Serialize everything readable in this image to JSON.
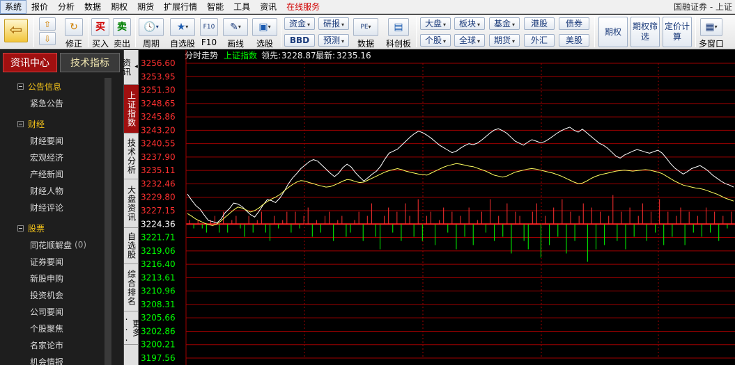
{
  "menubar": {
    "items": [
      "系统",
      "报价",
      "分析",
      "数据",
      "期权",
      "期货",
      "扩展行情",
      "智能",
      "工具",
      "资讯",
      "在线服务"
    ],
    "brand": "国融证券 - 上证"
  },
  "toolbar": {
    "buttons": {
      "back": "",
      "fix": "修正",
      "buy": "买入",
      "sell": "卖出",
      "period": "周期",
      "watchlist": "自选股",
      "f10": "F10",
      "draw": "画线",
      "pick": "选股",
      "data": "数据",
      "kcb": "科创板",
      "multi": "多窗口"
    },
    "buy_glyph": "买",
    "sell_glyph": "卖",
    "f10_glyph": "F10",
    "small": {
      "fund": "资金",
      "research": "研报",
      "bbd": "BBD",
      "forecast": "预测",
      "pe": "PE",
      "dapan": "大盘",
      "gegu": "个股",
      "bankuai": "板块",
      "quanqiu": "全球",
      "jijin": "基金",
      "qihuo": "期货",
      "ganggu": "港股",
      "waihui": "外汇",
      "zhaiquan": "债券",
      "meigu": "美股"
    },
    "big": {
      "option": "期权",
      "option_filter": "期权筛选",
      "pricing": "定价计算"
    }
  },
  "sidebar": {
    "tab_news": "资讯中心",
    "tab_tech": "技术指标",
    "groups": [
      {
        "title": "公告信息",
        "items": [
          {
            "label": "紧急公告",
            "count": ""
          }
        ]
      },
      {
        "title": "财经",
        "items": [
          {
            "label": "财经要闻",
            "count": ""
          },
          {
            "label": "宏观经济",
            "count": ""
          },
          {
            "label": "产经新闻",
            "count": ""
          },
          {
            "label": "财经人物",
            "count": ""
          },
          {
            "label": "财经评论",
            "count": ""
          }
        ]
      },
      {
        "title": "股票",
        "items": [
          {
            "label": "同花顺解盘",
            "count": "(0)"
          },
          {
            "label": "证券要闻",
            "count": ""
          },
          {
            "label": "新股申购",
            "count": ""
          },
          {
            "label": "投资机会",
            "count": ""
          },
          {
            "label": "公司要闻",
            "count": ""
          },
          {
            "label": "个股聚焦",
            "count": ""
          },
          {
            "label": "名家论市",
            "count": ""
          },
          {
            "label": "机会情报",
            "count": ""
          }
        ]
      }
    ]
  },
  "vtabs": [
    "资讯",
    "上证指数",
    "技术分析",
    "大盘资讯",
    "自选股",
    "综合排名",
    "更多"
  ],
  "chart_header": {
    "mode": "分时走势",
    "index": "上证指数",
    "lead_label": "领先:",
    "lead_value": "3228.87",
    "latest_label": "最新:",
    "latest_value": "3235.16"
  },
  "colors": {
    "up": "#ff3030",
    "down": "#00ff00",
    "grid": "#a00000",
    "price_line": "#ffffff",
    "lead_line": "#ffff60",
    "header_index": "#00ff00",
    "tab_active": "#a01010"
  },
  "chart_data": {
    "type": "line",
    "title": "分时走势",
    "y_ticks": [
      "3256.60",
      "3253.95",
      "3251.30",
      "3248.65",
      "3245.86",
      "3243.20",
      "3240.55",
      "3237.90",
      "3235.11",
      "3232.46",
      "3229.80",
      "3227.15",
      "3224.36",
      "3221.71",
      "3219.06",
      "3216.40",
      "3213.61",
      "3210.96",
      "3208.31",
      "3205.66",
      "3202.86",
      "3200.21",
      "3197.56"
    ],
    "prev_close": 3224.36,
    "ylim": [
      3197.56,
      3256.6
    ],
    "series": [
      {
        "name": "最新",
        "values": [
          3230.4,
          3229.2,
          3228.1,
          3227.4,
          3226.2,
          3225.1,
          3224.9,
          3224.6,
          3225.4,
          3226.7,
          3227.5,
          3228.6,
          3228.4,
          3227.9,
          3227.1,
          3226.3,
          3225.8,
          3226.9,
          3228.2,
          3229.3,
          3229.1,
          3228.7,
          3229.6,
          3230.9,
          3232.4,
          3233.6,
          3234.5,
          3235.5,
          3236.2,
          3236.9,
          3237.3,
          3237.0,
          3236.2,
          3235.4,
          3234.6,
          3233.9,
          3234.6,
          3235.7,
          3236.4,
          3235.8,
          3234.7,
          3233.8,
          3233.0,
          3233.7,
          3234.4,
          3235.0,
          3236.0,
          3237.4,
          3238.6,
          3239.0,
          3239.4,
          3240.2,
          3241.0,
          3241.8,
          3242.5,
          3243.0,
          3242.7,
          3242.2,
          3241.6,
          3240.9,
          3240.2,
          3239.7,
          3239.2,
          3238.7,
          3239.0,
          3239.6,
          3240.1,
          3240.5,
          3240.3,
          3240.6,
          3241.2,
          3241.9,
          3242.6,
          3243.2,
          3243.5,
          3243.1,
          3242.6,
          3241.8,
          3241.0,
          3240.6,
          3240.2,
          3240.8,
          3241.3,
          3241.0,
          3240.7,
          3240.9,
          3241.4,
          3242.0,
          3242.6,
          3243.1,
          3243.5,
          3243.8,
          3243.2,
          3242.8,
          3243.4,
          3242.7,
          3242.0,
          3241.3,
          3240.6,
          3240.2,
          3239.6,
          3238.8,
          3238.0,
          3237.6,
          3238.2,
          3238.6,
          3239.0,
          3239.3,
          3239.1,
          3238.8,
          3238.6,
          3238.9,
          3239.2,
          3238.6,
          3237.6,
          3236.5,
          3235.6,
          3235.0,
          3234.4,
          3234.9,
          3235.5,
          3235.8,
          3236.1,
          3235.6,
          3235.0,
          3234.2,
          3233.6,
          3233.0,
          3232.5,
          3232.2,
          3231.8
        ]
      },
      {
        "name": "领先",
        "values": [
          3226.5,
          3226.0,
          3225.4,
          3225.0,
          3224.6,
          3224.3,
          3224.1,
          3224.4,
          3225.0,
          3225.8,
          3226.5,
          3227.2,
          3227.8,
          3227.6,
          3227.2,
          3226.8,
          3227.1,
          3227.6,
          3228.3,
          3228.9,
          3229.4,
          3229.8,
          3230.3,
          3231.0,
          3231.7,
          3232.3,
          3232.8,
          3233.1,
          3233.0,
          3232.7,
          3232.5,
          3232.2,
          3232.0,
          3231.8,
          3231.9,
          3232.2,
          3232.6,
          3233.0,
          3233.3,
          3233.2,
          3232.9,
          3232.7,
          3232.8,
          3233.2,
          3233.6,
          3234.0,
          3234.4,
          3234.8,
          3235.1,
          3235.3,
          3235.5,
          3235.3,
          3235.0,
          3234.8,
          3234.6,
          3234.4,
          3234.3,
          3234.2,
          3234.6,
          3235.0,
          3235.4,
          3235.8,
          3236.1,
          3236.3,
          3236.5,
          3236.4,
          3236.2,
          3236.0,
          3235.9,
          3235.6,
          3235.3,
          3235.0,
          3234.6,
          3234.2,
          3234.0,
          3233.8,
          3234.0,
          3234.4,
          3234.8,
          3235.0,
          3235.2,
          3235.4,
          3235.5,
          3235.4,
          3235.2,
          3235.0,
          3234.8,
          3234.6,
          3234.3,
          3234.0,
          3233.6,
          3233.2,
          3232.8,
          3232.5,
          3232.6,
          3233.0,
          3233.5,
          3233.9,
          3234.2,
          3234.4,
          3234.6,
          3234.8,
          3235.0,
          3235.1,
          3235.2,
          3235.1,
          3235.0,
          3235.1,
          3235.2,
          3235.3,
          3235.2,
          3235.0,
          3234.8,
          3234.5,
          3234.0,
          3233.5,
          3233.0,
          3232.6,
          3232.2,
          3232.0,
          3231.8,
          3231.6,
          3231.5,
          3231.3,
          3231.0,
          3230.7,
          3230.4,
          3230.0,
          3229.6,
          3229.3,
          3229.0
        ]
      }
    ],
    "volume_bars": [
      1,
      -1,
      1,
      -1,
      -2,
      1,
      2,
      -2,
      3,
      -2,
      1,
      2,
      -1,
      -3,
      2,
      -2,
      1,
      3,
      -2,
      -4,
      2,
      -1,
      1,
      3,
      -2,
      3,
      -1,
      2,
      4,
      -3,
      1,
      -2,
      2,
      3,
      -4,
      1,
      2,
      -3,
      -2,
      1,
      3,
      -4,
      2,
      5,
      -3,
      -6,
      2,
      4,
      -2,
      3,
      -4,
      5,
      2,
      -3,
      6,
      -4,
      2,
      3,
      -5,
      1,
      4,
      -2,
      3,
      -6,
      2,
      -3,
      4,
      -5,
      1,
      3,
      -2,
      6,
      -4,
      2,
      -3,
      5,
      -7,
      3,
      2,
      -4,
      -6,
      3,
      5,
      -8,
      2,
      -5,
      4,
      -3,
      6,
      -7,
      3,
      -4,
      2,
      5,
      -9,
      4,
      -6,
      3,
      -5,
      2,
      7,
      -4,
      3,
      -6,
      4,
      -3,
      2,
      5,
      -4,
      3,
      -2,
      6,
      -5,
      3,
      -3,
      2,
      4,
      -5,
      3,
      -2,
      2,
      -3,
      4,
      -2,
      3,
      -4,
      2,
      -1,
      3
    ]
  }
}
